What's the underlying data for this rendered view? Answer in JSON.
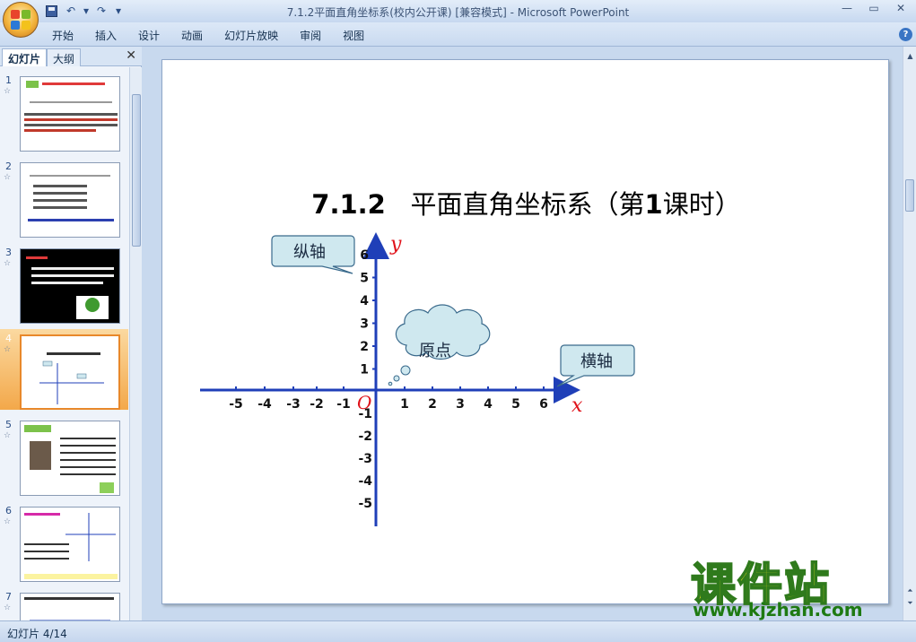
{
  "window": {
    "title": "7.1.2平面直角坐标系(校内公开课) [兼容模式] - Microsoft PowerPoint",
    "controls": [
      "—",
      "▭",
      "✕"
    ]
  },
  "quick_access": {
    "save_icon": "save-icon",
    "undo_icon": "↶",
    "undo_dropdown": "▾",
    "redo_icon": "↷",
    "customize": "▾"
  },
  "ribbon": {
    "tabs": [
      "开始",
      "插入",
      "设计",
      "动画",
      "幻灯片放映",
      "审阅",
      "视图"
    ],
    "help": "?"
  },
  "slides_pane": {
    "tab_slides": "幻灯片",
    "tab_outline": "大纲",
    "close": "✕",
    "selected_index": 4,
    "thumbnails": [
      {
        "num": "1",
        "mark": "☆"
      },
      {
        "num": "2",
        "mark": "☆"
      },
      {
        "num": "3",
        "mark": "☆"
      },
      {
        "num": "4",
        "mark": "☆"
      },
      {
        "num": "5",
        "mark": "☆"
      },
      {
        "num": "6",
        "mark": "☆"
      },
      {
        "num": "7",
        "mark": "☆"
      }
    ]
  },
  "slide": {
    "title_num": "7.1.2",
    "title_main": "平面直角坐标系（第",
    "title_bold": "1",
    "title_end": "课时）",
    "y_axis_label": "y",
    "x_axis_label": "x",
    "origin_label": "O",
    "x_ticks_neg": [
      "-5",
      "-4",
      "-3",
      "-2",
      "-1"
    ],
    "x_ticks_pos": [
      "1",
      "2",
      "3",
      "4",
      "5",
      "6"
    ],
    "y_ticks_pos": [
      "6",
      "5",
      "4",
      "3",
      "2",
      "1"
    ],
    "y_ticks_neg": [
      "-1",
      "-2",
      "-3",
      "-4",
      "-5"
    ],
    "callout_y": "纵轴",
    "callout_x": "横轴",
    "callout_origin": "原点",
    "colors": {
      "axis": "#1f3fb8",
      "axis_label": "#e0121a",
      "callout_fill": "#cfe8ef",
      "callout_stroke": "#3a6a8c"
    }
  },
  "watermark": {
    "cn": "课件站",
    "url": "www.kjzhan.com"
  },
  "status": {
    "slide_counter": "幻灯片 4/14"
  }
}
